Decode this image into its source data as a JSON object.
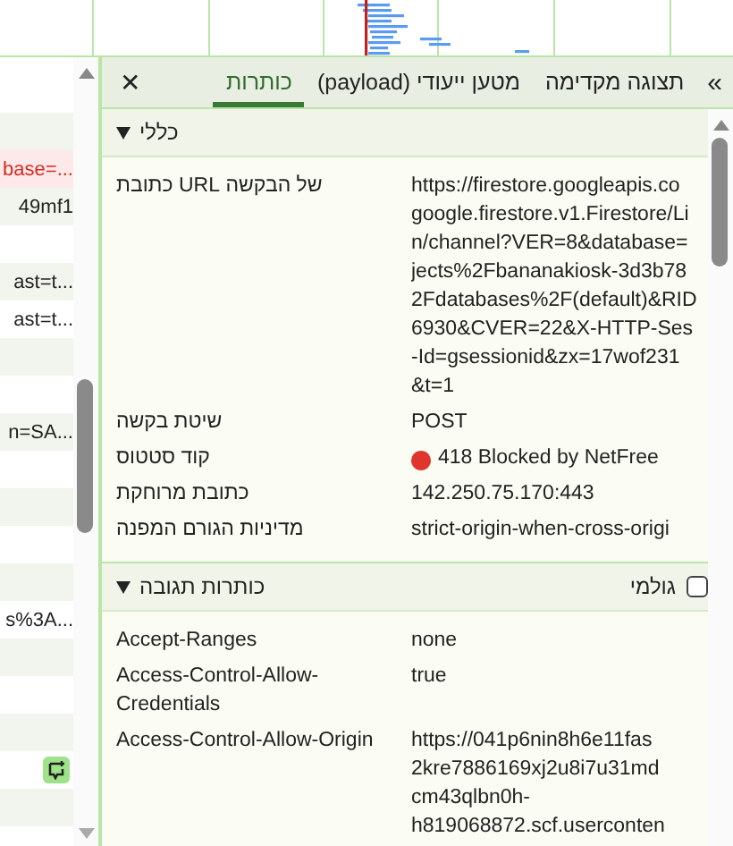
{
  "requests": [
    {
      "error": false,
      "overridden": false
    },
    {
      "text": "base=...",
      "error": true,
      "overridden": false
    },
    {
      "text": "49mf1",
      "error": false,
      "overridden": false
    },
    {
      "error": false,
      "overridden": false
    },
    {
      "text": "ast=t...",
      "error": false,
      "overridden": false
    },
    {
      "text": "ast=t...",
      "error": false,
      "overridden": false
    },
    {
      "error": false,
      "overridden": false
    },
    {
      "error": false,
      "overridden": false
    },
    {
      "text": "n=SA...",
      "error": false,
      "overridden": false
    },
    {
      "error": false,
      "overridden": false
    },
    {
      "error": false,
      "overridden": false
    },
    {
      "error": false,
      "overridden": false
    },
    {
      "error": false,
      "overridden": false
    },
    {
      "text": "s%3A...",
      "error": false,
      "overridden": false
    },
    {
      "error": false,
      "overridden": false
    },
    {
      "error": false,
      "overridden": false
    },
    {
      "error": false,
      "overridden": false
    },
    {
      "error": false,
      "overridden": true
    },
    {
      "error": false,
      "overridden": false
    }
  ],
  "tabs": [
    {
      "label": "תצוגה מקדימה",
      "selected": false
    },
    {
      "label": "מטען ייעודי (payload)",
      "selected": false
    },
    {
      "label": "כותרות",
      "selected": true
    }
  ],
  "close": "✕",
  "more": "»",
  "sections": [
    {
      "title": "כללי",
      "expanded": true,
      "rows": [
        {
          "label": "של הבקשה URL כתובת",
          "value": [
            "https://firestore.googleapis.co",
            "google.firestore.v1.Firestore/Li",
            "n/channel?VER=8&database=",
            "jects%2Fbananakiosk-3d3b78",
            "2Fdatabases%2F(default)&RID",
            "6930&CVER=22&X-HTTP-Ses",
            "-Id=gsessionid&zx=17wof231",
            "&t=1"
          ]
        },
        {
          "label": "שיטת בקשה",
          "value": [
            "POST"
          ]
        },
        {
          "label": "קוד סטטוס",
          "value": [
            "418 Blocked by NetFree"
          ],
          "color": "#e0352f"
        },
        {
          "label": "כתובת מרוחקת",
          "value": [
            "142.250.75.170:443"
          ]
        },
        {
          "label": "מדיניות הגורם המפנה",
          "value": [
            "strict-origin-when-cross-origi"
          ]
        }
      ]
    },
    {
      "title": "כותרות תגובה",
      "expanded": true,
      "raw": {
        "label": "גולמי",
        "checked": false
      },
      "rows": [
        {
          "label": "Accept-Ranges",
          "value": [
            "none"
          ]
        },
        {
          "label": "Access-Control-Allow-Credentials",
          "value": [
            "true"
          ]
        },
        {
          "label": "Access-Control-Allow-Origin",
          "value": [
            "https://041p6nin8h6e11fas",
            "2kre7886169xj2u8i7u31md",
            "cm43qlbn0h-",
            "h819068872.scf.userconten"
          ]
        }
      ]
    }
  ]
}
